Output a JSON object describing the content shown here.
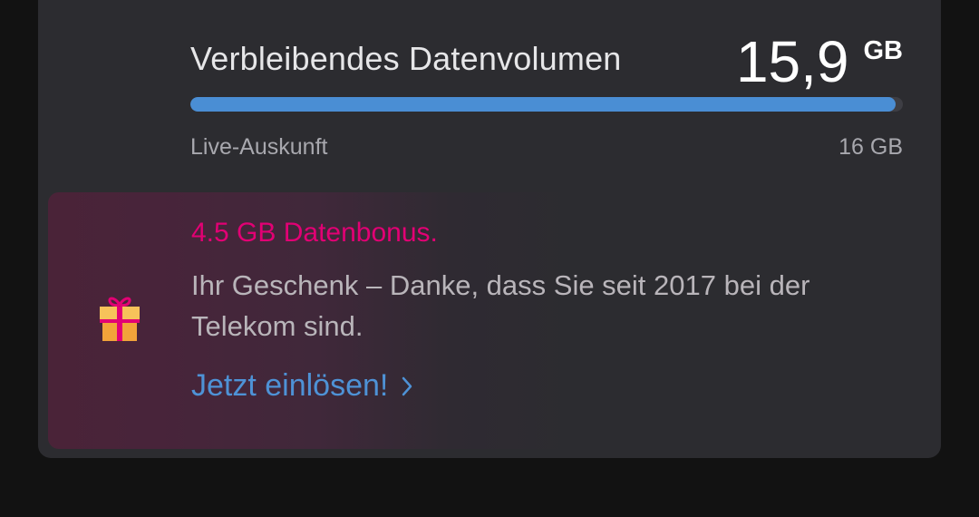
{
  "data_volume": {
    "label": "Verbleibendes Datenvolumen",
    "remaining_value": "15,9",
    "remaining_unit": "GB",
    "fill_fraction": 0.99,
    "source_label": "Live-Auskunft",
    "total_label": "16 GB",
    "bar_color": "#4a8ed4"
  },
  "bonus": {
    "icon": "gift-icon",
    "title": "4.5 GB Datenbonus.",
    "text": "Ihr Geschenk – Danke, dass Sie seit 2017 bei der Telekom sind.",
    "link_label": "Jetzt einlösen!",
    "link_icon": "chevron-right-icon",
    "title_color": "#e20074",
    "link_color": "#4e92d6"
  }
}
